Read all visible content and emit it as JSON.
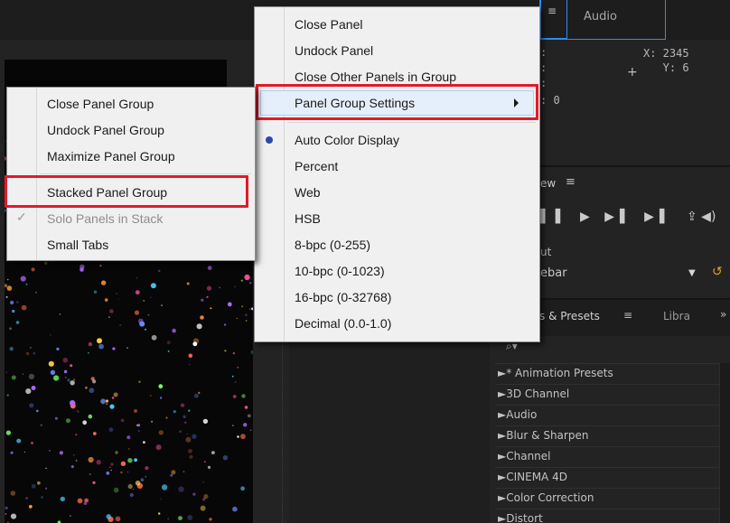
{
  "info": {
    "x": "X: 2345",
    "y": "Y: 6",
    "zero": ": 0"
  },
  "tabs": {
    "audio": "Audio"
  },
  "preview": {
    "title": "ew",
    "controls": "▌▌ ▶ ▶▌ ▶▌",
    "output_label": "ut",
    "output_value": "ebar"
  },
  "effects": {
    "tab_label": "s & Presets",
    "libraries_tab": "Libra",
    "items": [
      "►* Animation Presets",
      "►3D Channel",
      "►Audio",
      "►Blur & Sharpen",
      "►Channel",
      "►CINEMA 4D",
      "►Color Correction",
      "►Distort"
    ]
  },
  "main_menu": {
    "items": [
      {
        "label": "Close Panel"
      },
      {
        "label": "Undock Panel"
      },
      {
        "label": "Close Other Panels in Group"
      },
      {
        "label": "Panel Group Settings"
      },
      {
        "label": "Auto Color Display"
      },
      {
        "label": "Percent"
      },
      {
        "label": "Web"
      },
      {
        "label": "HSB"
      },
      {
        "label": "8-bpc (0-255)"
      },
      {
        "label": "10-bpc (0-1023)"
      },
      {
        "label": "16-bpc (0-32768)"
      },
      {
        "label": "Decimal (0.0-1.0)"
      }
    ]
  },
  "submenu": {
    "items": [
      {
        "label": "Close Panel Group"
      },
      {
        "label": "Undock Panel Group"
      },
      {
        "label": "Maximize Panel Group"
      },
      {
        "label": "Stacked Panel Group"
      },
      {
        "label": "Solo Panels in Stack"
      },
      {
        "label": "Small Tabs"
      }
    ]
  },
  "colors": {
    "highlight_box": "#e11a2a",
    "tab_accent": "#2d8ceb"
  }
}
